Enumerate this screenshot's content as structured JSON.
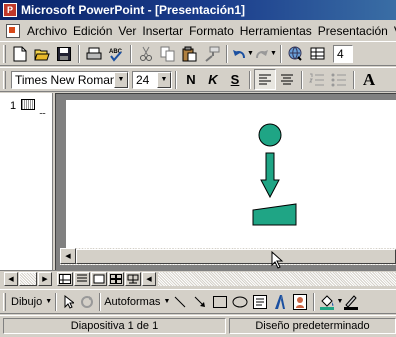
{
  "window": {
    "title": "Microsoft PowerPoint - [Presentación1]"
  },
  "menubar": {
    "items": [
      "Archivo",
      "Edición",
      "Ver",
      "Insertar",
      "Formato",
      "Herramientas",
      "Presentación",
      "V"
    ]
  },
  "standard_toolbar": {
    "zoom_partial": "4"
  },
  "format_toolbar": {
    "font_name": "Times New Roman",
    "font_size": "24",
    "bold": "N",
    "italic": "K",
    "underline": "S",
    "grow_font": "A"
  },
  "outline": {
    "slide_number": "1"
  },
  "slide": {
    "shape_color": "#1fa585"
  },
  "drawing_toolbar": {
    "draw_label": "Dibujo",
    "autoshapes_label": "Autoformas"
  },
  "statusbar": {
    "slide_info": "Diapositiva 1 de 1",
    "design": "Diseño predeterminado"
  }
}
